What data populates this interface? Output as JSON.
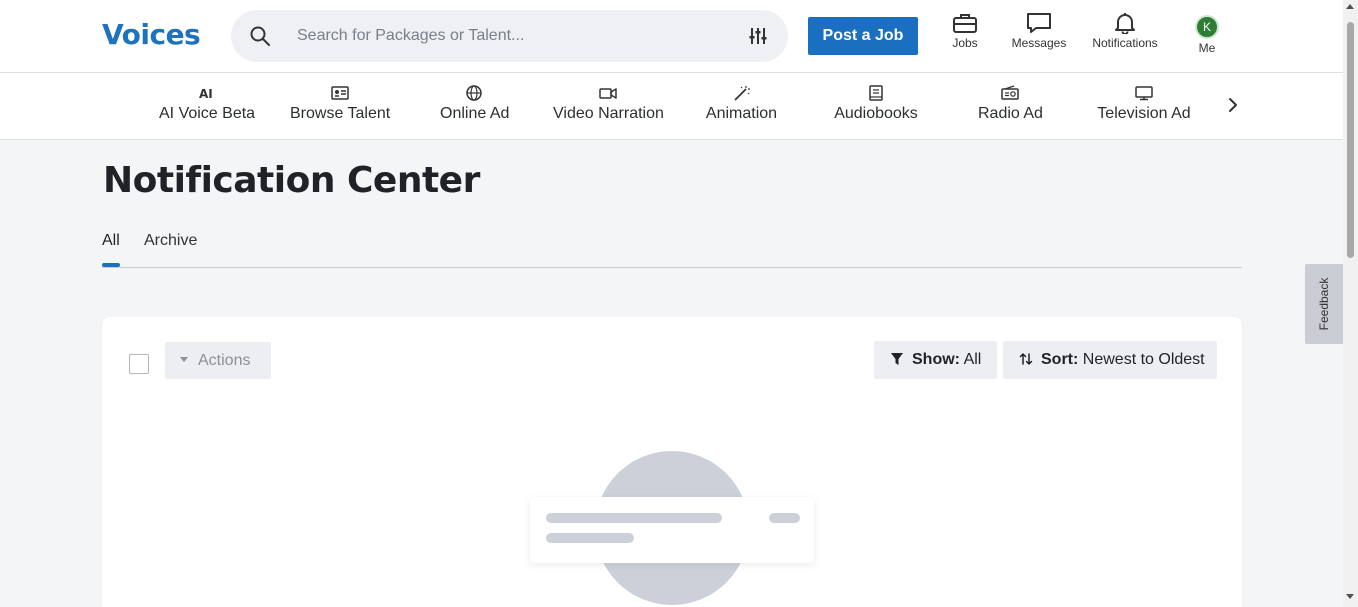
{
  "header": {
    "logo": "Voices",
    "search_placeholder": "Search for Packages or Talent...",
    "post_job_label": "Post a Job",
    "nav": {
      "jobs": "Jobs",
      "messages": "Messages",
      "notifications": "Notifications",
      "me": "Me",
      "avatar_initial": "K"
    }
  },
  "categories": [
    {
      "label": "AI Voice Beta",
      "icon": "ai-icon"
    },
    {
      "label": "Browse Talent",
      "icon": "id-card-icon"
    },
    {
      "label": "Online Ad",
      "icon": "globe-icon"
    },
    {
      "label": "Video Narration",
      "icon": "video-camera-icon"
    },
    {
      "label": "Animation",
      "icon": "magic-wand-icon"
    },
    {
      "label": "Audiobooks",
      "icon": "book-icon"
    },
    {
      "label": "Radio Ad",
      "icon": "radio-icon"
    },
    {
      "label": "Television Ad",
      "icon": "tv-icon"
    }
  ],
  "page": {
    "title": "Notification Center",
    "tabs": [
      {
        "label": "All",
        "active": true
      },
      {
        "label": "Archive",
        "active": false
      }
    ]
  },
  "toolbar": {
    "actions_label": "Actions",
    "show_key": "Show:",
    "show_value": "All",
    "sort_key": "Sort:",
    "sort_value": "Newest to Oldest"
  },
  "feedback_label": "Feedback",
  "colors": {
    "brand": "#1e73be",
    "primary_button": "#1a6fc0",
    "avatar": "#2e7d32",
    "page_bg": "#f4f5f7"
  }
}
